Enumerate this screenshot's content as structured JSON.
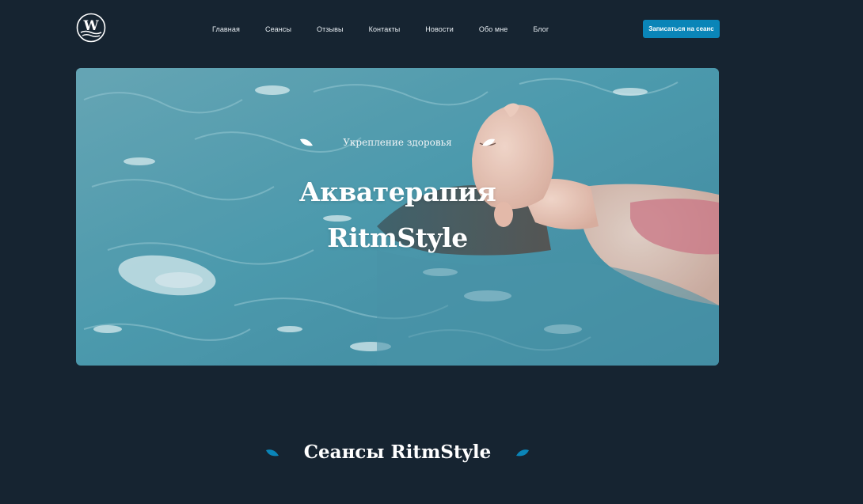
{
  "colors": {
    "background": "#162431",
    "accent": "#0a85b8",
    "water": "#3d8fa3"
  },
  "logo": {
    "letter": "W",
    "icon": "wave-logo-icon"
  },
  "nav": {
    "items": [
      {
        "label": "Главная"
      },
      {
        "label": "Сеансы"
      },
      {
        "label": "Отзывы"
      },
      {
        "label": "Контакты"
      },
      {
        "label": "Новости"
      },
      {
        "label": "Обо мне"
      },
      {
        "label": "Блог"
      }
    ]
  },
  "header": {
    "cta_label": "Записаться на сеанс"
  },
  "hero": {
    "kicker": "Укрепление здоровья",
    "title_line1": "Акватерапия",
    "title_line2": "RitmStyle",
    "image": "woman-floating-in-water-photo"
  },
  "sessions": {
    "title": "Сеансы RitmStyle"
  }
}
